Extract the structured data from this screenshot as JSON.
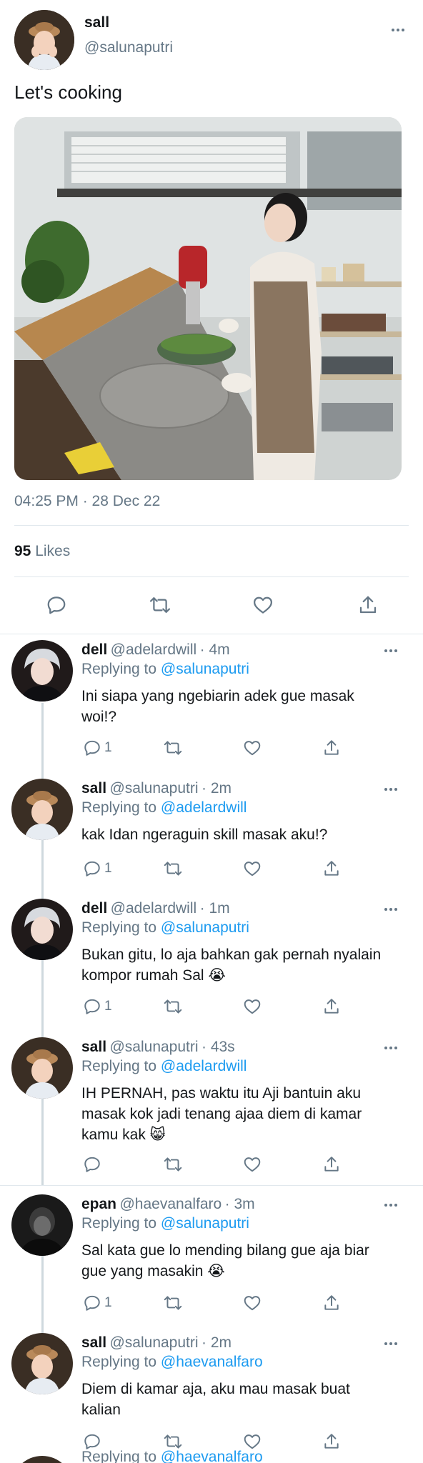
{
  "main_tweet": {
    "display_name": "sall",
    "handle": "@salunaputri",
    "text": "Let's cooking",
    "timestamp": "04:25 PM · 28 Dec 22",
    "likes_count": "95",
    "likes_label": "Likes"
  },
  "replies": [
    {
      "display_name": "dell",
      "handle": "@adelardwill",
      "time": "· 4m",
      "replying_prefix": "Replying to",
      "replying_to": "@salunaputri",
      "text": "Ini siapa yang ngebiarin adek gue masak woi!?",
      "reply_count": "1"
    },
    {
      "display_name": "sall",
      "handle": "@salunaputri",
      "time": "· 2m",
      "replying_prefix": "Replying to",
      "replying_to": "@adelardwill",
      "text": "kak Idan ngeraguin skill masak aku!?",
      "reply_count": "1"
    },
    {
      "display_name": "dell",
      "handle": "@adelardwill",
      "time": "· 1m",
      "replying_prefix": "Replying to",
      "replying_to": "@salunaputri",
      "text": "Bukan gitu, lo aja bahkan gak pernah nyalain kompor rumah Sal 😭",
      "reply_count": "1"
    },
    {
      "display_name": "sall",
      "handle": "@salunaputri",
      "time": "· 43s",
      "replying_prefix": "Replying to",
      "replying_to": "@adelardwill",
      "text": "IH PERNAH,  pas waktu itu Aji bantuin aku masak kok  jadi tenang ajaa diem di kamar kamu kak 😸",
      "reply_count": ""
    },
    {
      "display_name": "epan",
      "handle": "@haevanalfaro",
      "time": "· 3m",
      "replying_prefix": "Replying to",
      "replying_to": "@salunaputri",
      "text": "Sal kata gue lo mending bilang gue aja biar gue yang masakin 😭",
      "reply_count": "1"
    },
    {
      "display_name": "sall",
      "handle": "@salunaputri",
      "time": "· 2m",
      "replying_prefix": "Replying to",
      "replying_to": "@haevanalfaro",
      "text": "Diem di kamar aja, aku mau masak buat kalian",
      "reply_count": ""
    }
  ],
  "partial_next": {
    "replying_prefix": "Replying to",
    "replying_to": "@haevanalfaro"
  },
  "colors": {
    "link": "#1d9bf0",
    "secondary_text": "#657786",
    "divider": "#e1e8ed",
    "thread_line": "#cfd9de"
  }
}
